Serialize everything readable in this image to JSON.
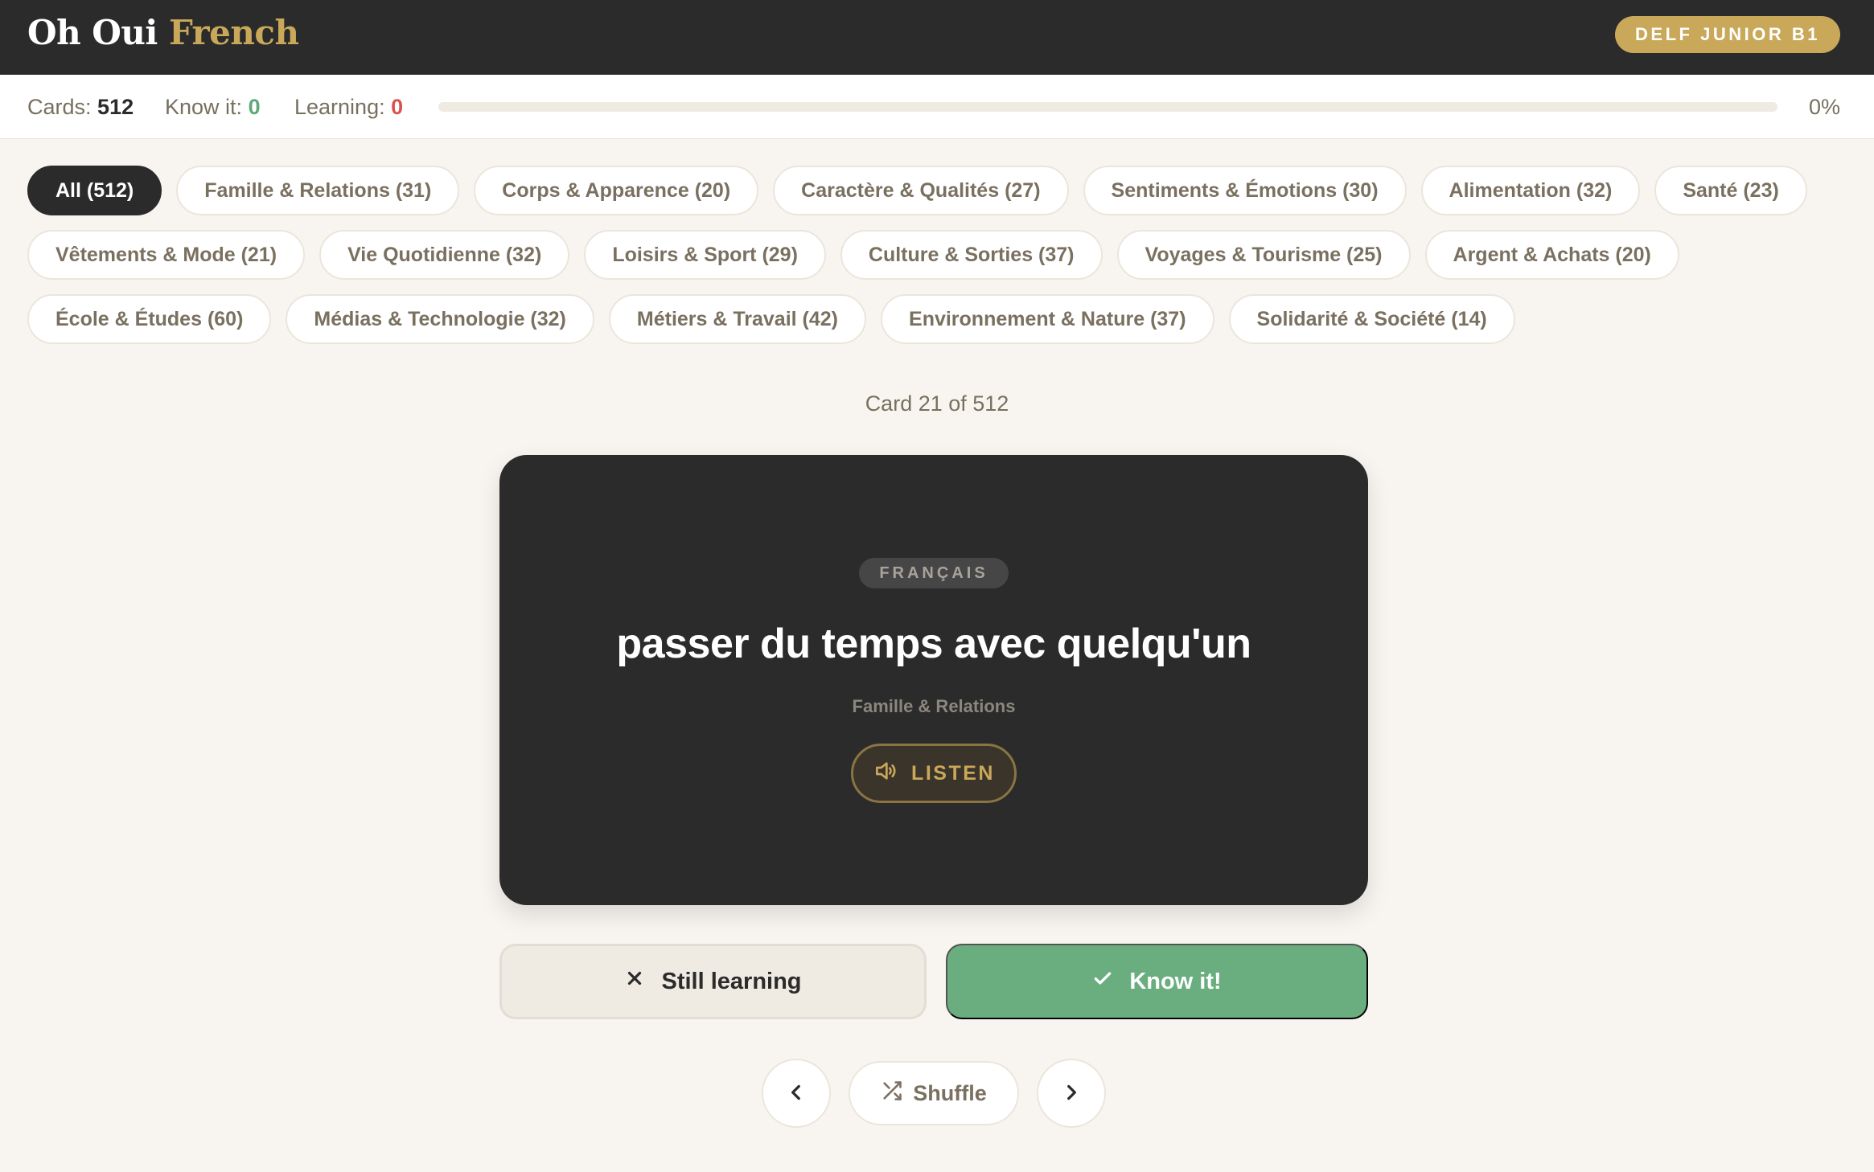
{
  "header": {
    "logo_primary": "Oh Oui",
    "logo_accent": "French",
    "level_badge": "DELF JUNIOR B1"
  },
  "stats": {
    "cards_label": "Cards:",
    "cards_value": "512",
    "know_label": "Know it:",
    "know_value": "0",
    "learning_label": "Learning:",
    "learning_value": "0",
    "progress_fraction": 0,
    "progress_label": "0%"
  },
  "filters": [
    {
      "label": "All (512)",
      "active": true
    },
    {
      "label": "Famille & Relations (31)",
      "active": false
    },
    {
      "label": "Corps & Apparence (20)",
      "active": false
    },
    {
      "label": "Caractère & Qualités (27)",
      "active": false
    },
    {
      "label": "Sentiments & Émotions (30)",
      "active": false
    },
    {
      "label": "Alimentation (32)",
      "active": false
    },
    {
      "label": "Santé (23)",
      "active": false
    },
    {
      "label": "Vêtements & Mode (21)",
      "active": false
    },
    {
      "label": "Vie Quotidienne (32)",
      "active": false
    },
    {
      "label": "Loisirs & Sport (29)",
      "active": false
    },
    {
      "label": "Culture & Sorties (37)",
      "active": false
    },
    {
      "label": "Voyages & Tourisme (25)",
      "active": false
    },
    {
      "label": "Argent & Achats (20)",
      "active": false
    },
    {
      "label": "École & Études (60)",
      "active": false
    },
    {
      "label": "Médias & Technologie (32)",
      "active": false
    },
    {
      "label": "Métiers & Travail (42)",
      "active": false
    },
    {
      "label": "Environnement & Nature (37)",
      "active": false
    },
    {
      "label": "Solidarité & Société (14)",
      "active": false
    }
  ],
  "counter": "Card 21 of 512",
  "card": {
    "language_badge": "FRANÇAIS",
    "phrase": "passer du temps avec quelqu'un",
    "category": "Famille & Relations",
    "listen_label": "LISTEN"
  },
  "actions": {
    "still_learning_label": "Still learning",
    "know_it_label": "Know it!"
  },
  "nav": {
    "shuffle_label": "Shuffle",
    "prev_icon": "chevron-left-icon",
    "next_icon": "chevron-right-icon"
  },
  "colors": {
    "dark": "#2b2b2b",
    "gold": "#c9a85a",
    "green": "#6aae80",
    "red": "#d9544f",
    "background": "#f8f5f0"
  }
}
